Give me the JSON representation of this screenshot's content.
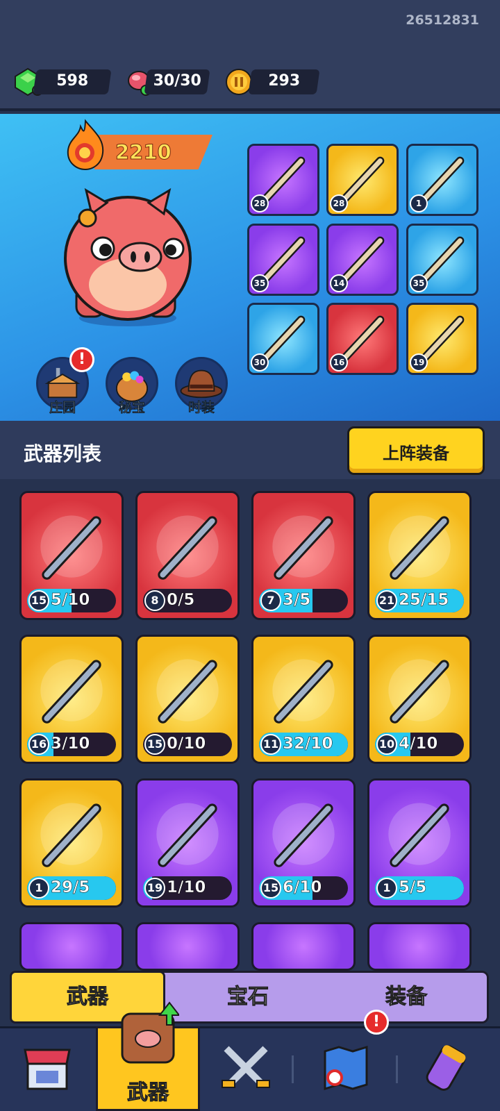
{
  "uid": "26512831",
  "resources": {
    "gems": "598",
    "energy": "30/30",
    "coins": "293"
  },
  "hero": {
    "power": "2210",
    "buttons": {
      "farm": "庄园",
      "treasure": "秘宝",
      "fashion": "时装"
    }
  },
  "equipped": [
    {
      "level": "28",
      "color": "purple"
    },
    {
      "level": "28",
      "color": "yellow"
    },
    {
      "level": "1",
      "color": "blue"
    },
    {
      "level": "35",
      "color": "purple"
    },
    {
      "level": "14",
      "color": "purple"
    },
    {
      "level": "35",
      "color": "blue"
    },
    {
      "level": "30",
      "color": "blue"
    },
    {
      "level": "16",
      "color": "red"
    },
    {
      "level": "19",
      "color": "yellow"
    }
  ],
  "list": {
    "title": "武器列表",
    "deploy_label": "上阵装备"
  },
  "weapons": [
    {
      "level": "15",
      "count": "5/10",
      "color": "red",
      "progress": 0.5
    },
    {
      "level": "8",
      "count": "0/5",
      "color": "red",
      "progress": 0
    },
    {
      "level": "7",
      "count": "3/5",
      "color": "red",
      "progress": 0.6
    },
    {
      "level": "21",
      "count": "25/15",
      "color": "yellow",
      "progress": 1
    },
    {
      "level": "16",
      "count": "3/10",
      "color": "yellow",
      "progress": 0.3
    },
    {
      "level": "15",
      "count": "0/10",
      "color": "yellow",
      "progress": 0
    },
    {
      "level": "11",
      "count": "32/10",
      "color": "yellow",
      "progress": 1
    },
    {
      "level": "10",
      "count": "4/10",
      "color": "yellow",
      "progress": 0.4
    },
    {
      "level": "1",
      "count": "29/5",
      "color": "yellow",
      "progress": 1
    },
    {
      "level": "19",
      "count": "1/10",
      "color": "purple",
      "progress": 0.1
    },
    {
      "level": "15",
      "count": "6/10",
      "color": "purple",
      "progress": 0.6
    },
    {
      "level": "1",
      "count": "5/5",
      "color": "purple",
      "progress": 1
    }
  ],
  "tabs": {
    "weapons": "武器",
    "gems": "宝石",
    "equipment": "装备"
  },
  "nav": {
    "weapons_label": "武器"
  },
  "badges": {
    "alert": "!"
  }
}
